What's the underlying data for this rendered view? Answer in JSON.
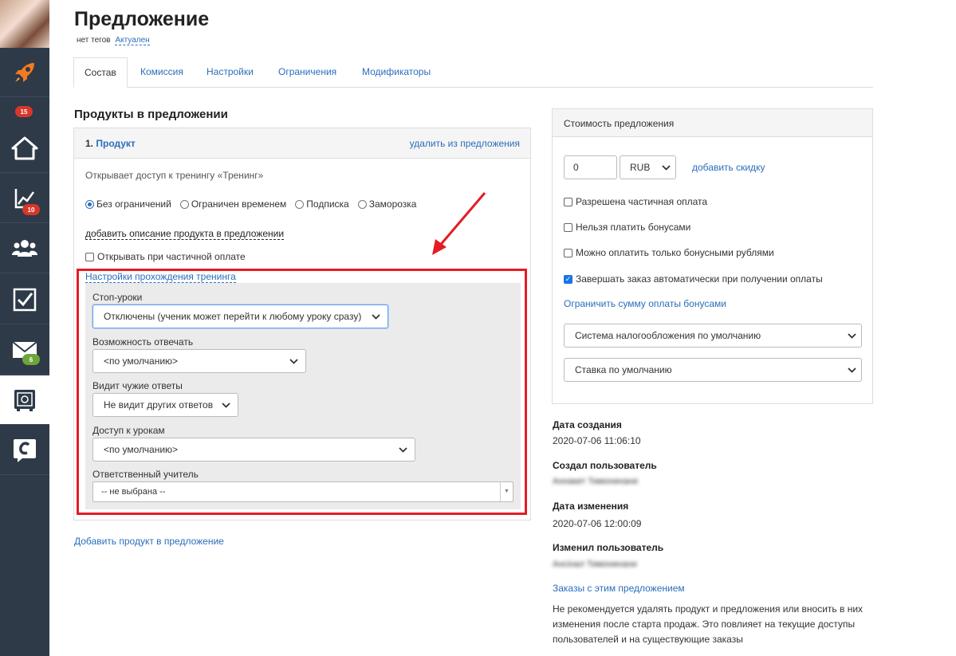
{
  "sidebar": {
    "items": [
      {
        "name": "rocket",
        "badge": "15",
        "badge_color": "#d9362b"
      },
      {
        "name": "home"
      },
      {
        "name": "chart",
        "badge": "10",
        "badge_color": "#d9362b"
      },
      {
        "name": "users"
      },
      {
        "name": "tasks"
      },
      {
        "name": "mail",
        "badge": "6",
        "badge_color": "#6da53a"
      },
      {
        "name": "safe"
      },
      {
        "name": "chat"
      }
    ]
  },
  "header": {
    "title": "Предложение",
    "tags": "нет тегов",
    "status": "Актуален"
  },
  "tabs": [
    "Состав",
    "Комиссия",
    "Настройки",
    "Ограничения",
    "Модификаторы"
  ],
  "main": {
    "section_title": "Продукты в предложении",
    "product": {
      "number": "1.",
      "name": "Продукт",
      "remove_link": "удалить из предложения",
      "access_text": "Открывает доступ к тренингу «Тренинг»",
      "radios": [
        "Без ограничений",
        "Ограничен временем",
        "Подписка",
        "Заморозка"
      ],
      "selected_radio": "Без ограничений",
      "add_description": "добавить описание продукта в предложении",
      "partial_checkbox": "Открывать при частичной оплате",
      "training_settings_link": "Настройки прохождения тренинга",
      "fields": {
        "stop_lessons": {
          "label": "Стоп-уроки",
          "value": "Отключены (ученик может перейти к любому уроку сразу)"
        },
        "can_answer": {
          "label": "Возможность отвечать",
          "value": "<по умолчанию>"
        },
        "sees_others": {
          "label": "Видит чужие ответы",
          "value": "Не видит других ответов"
        },
        "lesson_access": {
          "label": "Доступ к урокам",
          "value": "<по умолчанию>"
        },
        "teacher": {
          "label": "Ответственный учитель",
          "value": "-- не выбрана --"
        }
      }
    },
    "add_product_link": "Добавить продукт в предложение"
  },
  "pricing": {
    "title": "Стоимость предложения",
    "price": "0",
    "currency": "RUB",
    "add_discount": "добавить скидку",
    "checkboxes": [
      {
        "label": "Разрешена частичная оплата",
        "checked": false
      },
      {
        "label": "Нельзя платить бонусами",
        "checked": false
      },
      {
        "label": "Можно оплатить только бонусными рублями",
        "checked": false
      },
      {
        "label": "Завершать заказ автоматически при получении оплаты",
        "checked": true
      }
    ],
    "limit_bonus_link": "Ограничить сумму оплаты бонусами",
    "tax_system": "Система налогообложения по умолчанию",
    "tax_rate": "Ставка по умолчанию"
  },
  "meta": {
    "created_label": "Дата создания",
    "created_value": "2020-07-06 11:06:10",
    "creator_label": "Создал пользователь",
    "creator_value": "Аннакет Тимонинани",
    "modified_label": "Дата изменения",
    "modified_value": "2020-07-06 12:00:09",
    "modifier_label": "Изменил пользователь",
    "modifier_value": "Ансінал Тимонинани",
    "orders_link": "Заказы с этим предложением",
    "warning": "Не рекомендуется удалять продукт и предложения или вносить в них изменения после старта продаж. Это повлияет на текущие доступы пользователей и на существующие заказы"
  },
  "annotation_color": "#e51c23"
}
